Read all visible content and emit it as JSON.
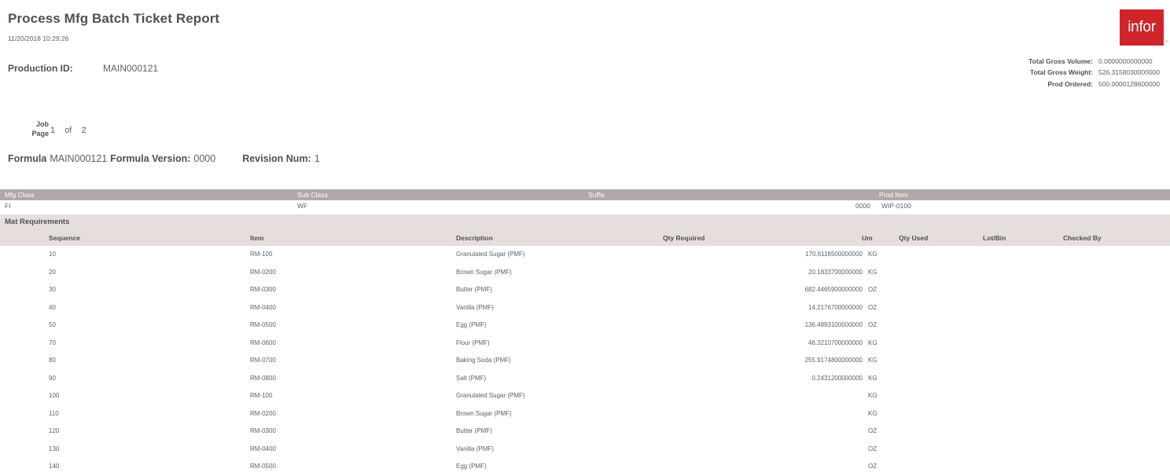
{
  "report": {
    "title": "Process Mfg Batch Ticket Report",
    "timestamp": "11/20/2018 10:29:26",
    "production_id_label": "Production ID:",
    "production_id_value": "MAIN000121"
  },
  "brand": {
    "logo_text": "infor",
    "logo_color": "#d0242b",
    "trademark": "™"
  },
  "totals": [
    {
      "label": "Total Gross Volume:",
      "value": "0.0000000000000"
    },
    {
      "label": "Total Gross Weight:",
      "value": "526.3158030000000"
    },
    {
      "label": "Prod Ordered:",
      "value": "500.0000128600000"
    }
  ],
  "job_page": {
    "job_label": "Job",
    "page_label": "Page",
    "job_value": "1",
    "of_label": "of",
    "page_value": "2"
  },
  "formula": {
    "formula_label": "Formula",
    "formula_value": "MAIN000121",
    "version_label": "Formula Version:",
    "version_value": "0000",
    "revision_label": "Revision Num:",
    "revision_value": "1"
  },
  "class_table": {
    "headers": {
      "mfg_class": "Mfg Class",
      "sub_class": "Sub Class",
      "suffix": "Suffix",
      "prod_item": "Prod Item"
    },
    "row": {
      "mfg_class": "FI",
      "sub_class": "WF",
      "suffix": "0000",
      "prod_item": "WIP-0100"
    }
  },
  "mat_requirements": {
    "section_title": "Mat Requirements",
    "headers": {
      "sequence": "Sequence",
      "item": "Item",
      "description": "Description",
      "qty_required": "Qty Required",
      "um": "Um",
      "qty_used": "Qty Used",
      "lot_bin": "Lot/Bin",
      "checked_by": "Checked By"
    },
    "rows": [
      {
        "sequence": "10",
        "item": "RM-100",
        "description": "Granulated Sugar (PMF)",
        "qty_required": "170.6116500000000",
        "um": "KG",
        "qty_used": "",
        "lot_bin": "",
        "checked_by": ""
      },
      {
        "sequence": "20",
        "item": "RM-0200",
        "description": "Brown Sugar (PMF)",
        "qty_required": "20.1833700000000",
        "um": "KG",
        "qty_used": "",
        "lot_bin": "",
        "checked_by": ""
      },
      {
        "sequence": "30",
        "item": "RM-0300",
        "description": "Butter (PMF)",
        "qty_required": "682.4465900000000",
        "um": "OZ",
        "qty_used": "",
        "lot_bin": "",
        "checked_by": ""
      },
      {
        "sequence": "40",
        "item": "RM-0400",
        "description": "Vanilla (PMF)",
        "qty_required": "14.2176700000000",
        "um": "OZ",
        "qty_used": "",
        "lot_bin": "",
        "checked_by": ""
      },
      {
        "sequence": "50",
        "item": "RM-0500",
        "description": "Egg  (PMF)",
        "qty_required": "136.4893100000000",
        "um": "OZ",
        "qty_used": "",
        "lot_bin": "",
        "checked_by": ""
      },
      {
        "sequence": "70",
        "item": "RM-0600",
        "description": "Flour (PMF)",
        "qty_required": "46.3210700000000",
        "um": "KG",
        "qty_used": "",
        "lot_bin": "",
        "checked_by": ""
      },
      {
        "sequence": "80",
        "item": "RM-0700",
        "description": "Baking Soda (PMF)",
        "qty_required": "255.9174800000000",
        "um": "KG",
        "qty_used": "",
        "lot_bin": "",
        "checked_by": ""
      },
      {
        "sequence": "90",
        "item": "RM-0800",
        "description": "Salt (PMF)",
        "qty_required": "0.2431200000000",
        "um": "KG",
        "qty_used": "",
        "lot_bin": "",
        "checked_by": ""
      },
      {
        "sequence": "100",
        "item": "RM-100",
        "description": "Granulated Sugar (PMF)",
        "qty_required": "",
        "um": "KG",
        "qty_used": "",
        "lot_bin": "",
        "checked_by": ""
      },
      {
        "sequence": "110",
        "item": "RM-0200",
        "description": "Brown Sugar (PMF)",
        "qty_required": "",
        "um": "KG",
        "qty_used": "",
        "lot_bin": "",
        "checked_by": ""
      },
      {
        "sequence": "120",
        "item": "RM-0300",
        "description": "Butter (PMF)",
        "qty_required": "",
        "um": "OZ",
        "qty_used": "",
        "lot_bin": "",
        "checked_by": ""
      },
      {
        "sequence": "130",
        "item": "RM-0400",
        "description": "Vanilla (PMF)",
        "qty_required": "",
        "um": "OZ",
        "qty_used": "",
        "lot_bin": "",
        "checked_by": ""
      },
      {
        "sequence": "140",
        "item": "RM-0500",
        "description": "Egg  (PMF)",
        "qty_required": "",
        "um": "OZ",
        "qty_used": "",
        "lot_bin": "",
        "checked_by": ""
      }
    ]
  },
  "colors": {
    "header_band": "#b1a8a8",
    "section_band": "#e6dedd",
    "text": "#5c6066",
    "heading_text": "#4d5156"
  }
}
